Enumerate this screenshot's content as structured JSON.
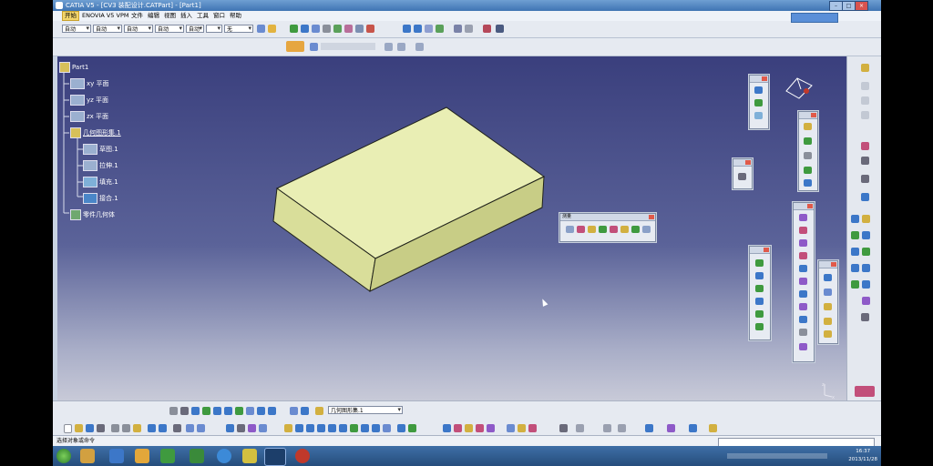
{
  "window": {
    "title": "CATIA V5 - [CV3 装配设计.CATPart] - [Part1]"
  },
  "menu": {
    "items": [
      "开始",
      "ENOVIA V5 VPM",
      "文件",
      "编辑",
      "视图",
      "插入",
      "工具",
      "窗口",
      "帮助"
    ],
    "active_index": 0
  },
  "toolbar": {
    "combos": [
      "自动",
      "自动",
      "自动",
      "自动",
      "自动",
      "",
      "无"
    ]
  },
  "tree": {
    "root": "Part1",
    "items": [
      {
        "label": "xy 平面"
      },
      {
        "label": "yz 平面"
      },
      {
        "label": "zx 平面"
      },
      {
        "label": "几何图形集.1"
      },
      {
        "label": "草图.1"
      },
      {
        "label": "拉伸.1"
      },
      {
        "label": "填充.1"
      },
      {
        "label": "接合.1"
      },
      {
        "label": "零件几何体"
      }
    ]
  },
  "palettes": {
    "floating_title": "测量"
  },
  "bottom": {
    "selector_value": "几何图形集.1"
  },
  "status": {
    "text": "选择对象或命令"
  },
  "clock": {
    "time": "16:37",
    "date": "2013/11/28"
  },
  "colors": {
    "viewport_top": "#3a3f7d",
    "viewport_bottom": "#c8cad8",
    "solid_top": "#e9eeb4",
    "solid_front": "#d9de9a",
    "solid_side": "#c8cd86",
    "edge": "#20221a"
  },
  "icons": {
    "window_controls": [
      "minimize-icon",
      "restore-icon",
      "close-icon"
    ],
    "compass": "compass-icon",
    "axis": "axis-triad-icon"
  }
}
